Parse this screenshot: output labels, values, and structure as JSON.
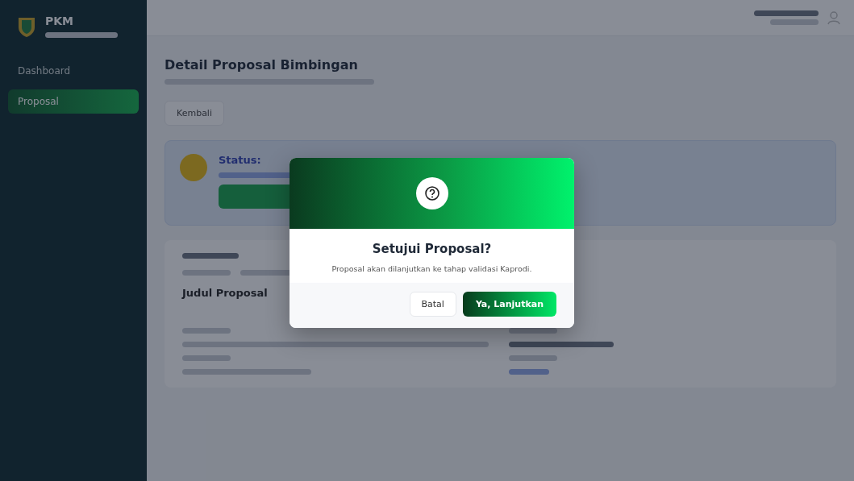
{
  "sidebar": {
    "brand": "PKM",
    "items": [
      {
        "label": "Dashboard",
        "selected": false
      },
      {
        "label": "Proposal",
        "selected": true
      }
    ]
  },
  "page": {
    "title": "Detail Proposal Bimbingan",
    "back_button": "Kembali",
    "status_title": "Status:",
    "section_title": "Judul Proposal"
  },
  "dialog": {
    "title": "Setujui Proposal?",
    "message": "Proposal akan dilanjutkan ke tahap validasi Kaprodi.",
    "buttons": [
      {
        "label": "Batal",
        "kind": "secondary"
      },
      {
        "label": "Ya, Lanjutkan",
        "kind": "primary"
      }
    ]
  }
}
